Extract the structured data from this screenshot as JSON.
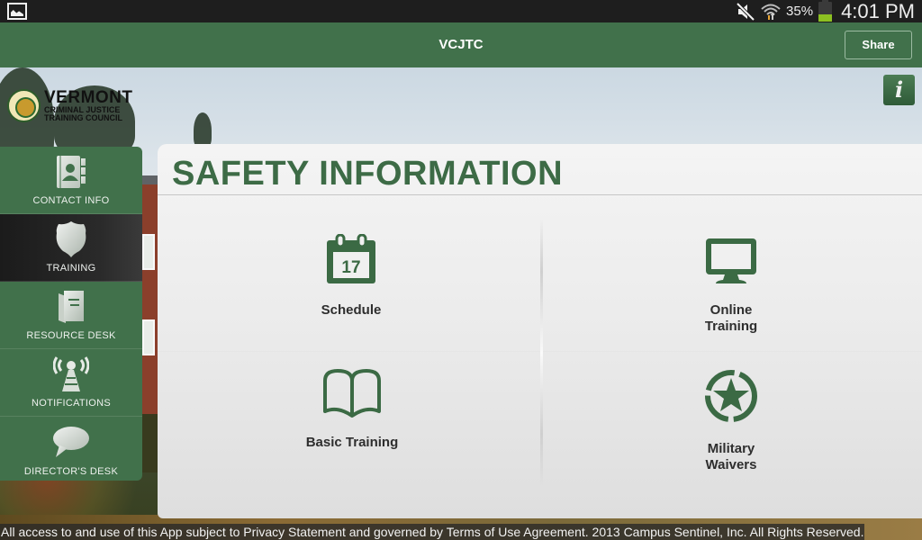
{
  "status_bar": {
    "battery_percent": "35%",
    "battery_level": 0.35,
    "time": "4:01 PM",
    "icons": [
      "gallery-icon",
      "mute-icon",
      "wifi-icon",
      "battery-icon"
    ]
  },
  "action_bar": {
    "title": "VCJTC",
    "share_label": "Share"
  },
  "logo": {
    "line1": "VERMONT",
    "line2": "CRIMINAL JUSTICE",
    "line3": "TRAINING COUNCIL"
  },
  "info_button": {
    "glyph": "i"
  },
  "sidebar": {
    "items": [
      {
        "label": "CONTACT INFO",
        "icon": "address-book-icon",
        "active": false
      },
      {
        "label": "TRAINING",
        "icon": "badge-shield-icon",
        "active": true
      },
      {
        "label": "RESOURCE DESK",
        "icon": "document-icon",
        "active": false
      },
      {
        "label": "NOTIFICATIONS",
        "icon": "broadcast-tower-icon",
        "active": false
      },
      {
        "label": "DIRECTOR'S DESK",
        "icon": "speech-bubble-icon",
        "active": false
      }
    ]
  },
  "main": {
    "title": "SAFETY INFORMATION",
    "tiles": [
      {
        "label": "Schedule",
        "icon": "calendar-icon",
        "calendar_day": "17"
      },
      {
        "label": "Online Training",
        "label_lines": [
          "Online",
          "Training"
        ],
        "icon": "monitor-icon"
      },
      {
        "label": "Basic Training",
        "icon": "open-book-icon"
      },
      {
        "label": "Military Waivers",
        "label_lines": [
          "Military",
          "Waivers"
        ],
        "icon": "star-circle-icon"
      }
    ]
  },
  "footer": {
    "text": "All access to and use of this App subject to Privacy Statement and governed by Terms of Use Agreement. 2013 Campus Sentinel, Inc. All Rights Reserved."
  },
  "colors": {
    "brand_green": "#41714b",
    "title_green": "#3d6b46",
    "icon_green": "#3b6a44",
    "status_bar": "#1e1e1e",
    "sidebar_active": "#1b1b1b",
    "battery_fill": "#8cc021"
  }
}
